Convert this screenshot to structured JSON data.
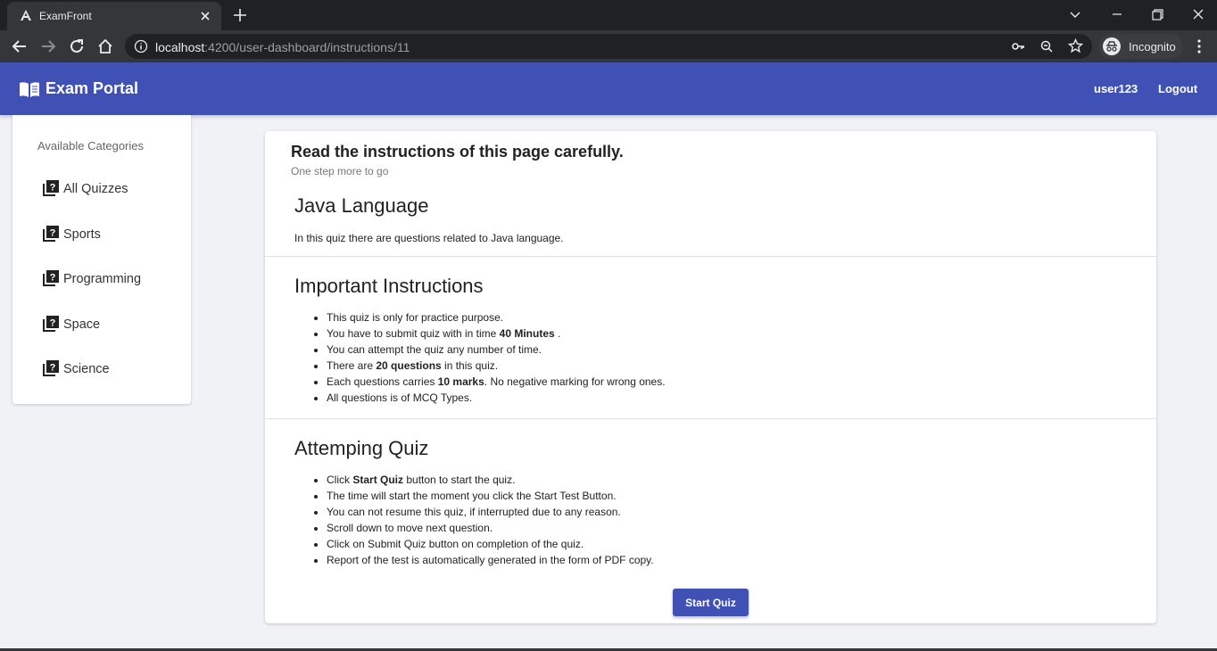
{
  "browser": {
    "tab_title": "ExamFront",
    "url_host": "localhost",
    "url_path": ":4200/user-dashboard/instructions/11",
    "profile_label": "Incognito"
  },
  "navbar": {
    "brand": "Exam Portal",
    "user": "user123",
    "logout": "Logout",
    "color": "#3f51b5"
  },
  "sidebar": {
    "heading": "Available Categories",
    "items": [
      {
        "label": "All Quizzes",
        "icon": "quiz-icon"
      },
      {
        "label": "Sports",
        "icon": "quiz-icon"
      },
      {
        "label": "Programming",
        "icon": "quiz-icon"
      },
      {
        "label": "Space",
        "icon": "quiz-icon"
      },
      {
        "label": "Science",
        "icon": "quiz-icon"
      }
    ]
  },
  "main": {
    "title": "Read the instructions of this page carefully.",
    "subtitle": "One step more to go",
    "quiz_title": "Java Language",
    "quiz_description": "In this quiz there are questions related to Java language.",
    "important_title": "Important Instructions",
    "important": [
      {
        "pre": "This quiz is only for practice purpose.",
        "bold": "",
        "post": ""
      },
      {
        "pre": "You have to submit quiz with in time ",
        "bold": "40 Minutes",
        "post": " ."
      },
      {
        "pre": "You can attempt the quiz any number of time.",
        "bold": "",
        "post": ""
      },
      {
        "pre": "There are ",
        "bold": "20 questions",
        "post": " in this quiz."
      },
      {
        "pre": "Each questions carries ",
        "bold": "10 marks",
        "post": ". No negative marking for wrong ones."
      },
      {
        "pre": "All questions is of MCQ Types.",
        "bold": "",
        "post": ""
      }
    ],
    "attempting_title": "Attemping Quiz",
    "attempting": [
      {
        "pre": "Click ",
        "bold": "Start Quiz",
        "post": " button to start the quiz."
      },
      {
        "pre": "The time will start the moment you click the Start Test Button.",
        "bold": "",
        "post": ""
      },
      {
        "pre": "You can not resume this quiz, if interrupted due to any reason.",
        "bold": "",
        "post": ""
      },
      {
        "pre": "Scroll down to move next question.",
        "bold": "",
        "post": ""
      },
      {
        "pre": "Click on Submit Quiz button on completion of the quiz.",
        "bold": "",
        "post": ""
      },
      {
        "pre": "Report of the test is automatically generated in the form of PDF copy.",
        "bold": "",
        "post": ""
      }
    ],
    "start_button": "Start Quiz"
  }
}
